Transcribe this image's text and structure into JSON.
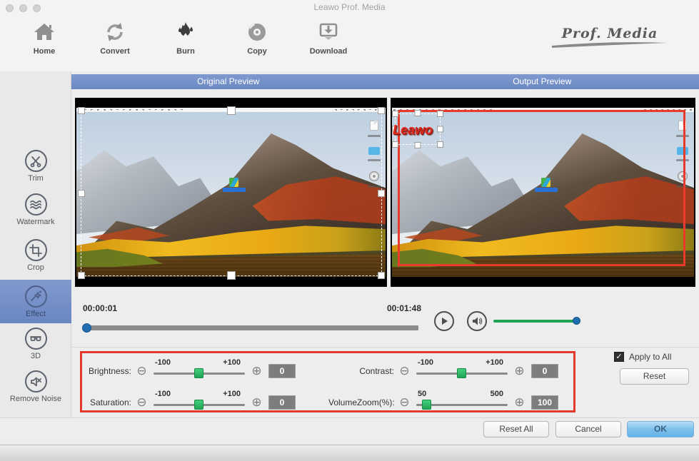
{
  "window": {
    "title": "Leawo Prof. Media",
    "brand": "Prof. Media"
  },
  "toolbar": {
    "items": [
      {
        "id": "home",
        "label": "Home"
      },
      {
        "id": "convert",
        "label": "Convert"
      },
      {
        "id": "burn",
        "label": "Burn"
      },
      {
        "id": "copy",
        "label": "Copy"
      },
      {
        "id": "download",
        "label": "Download"
      }
    ]
  },
  "sidebar": {
    "items": [
      {
        "id": "trim",
        "label": "Trim",
        "selected": false
      },
      {
        "id": "watermark",
        "label": "Watermark",
        "selected": false
      },
      {
        "id": "crop",
        "label": "Crop",
        "selected": false
      },
      {
        "id": "effect",
        "label": "Effect",
        "selected": true
      },
      {
        "id": "3d",
        "label": "3D",
        "selected": false
      },
      {
        "id": "remove-noise",
        "label": "Remove Noise",
        "selected": false
      }
    ]
  },
  "preview": {
    "original_label": "Original Preview",
    "output_label": "Output Preview",
    "watermark_text": "Leawo"
  },
  "timeline": {
    "current_time": "00:00:01",
    "total_time": "00:01:48"
  },
  "effects": {
    "sliders": [
      {
        "label": "Brightness:",
        "min": "-100",
        "max": "+100",
        "value": "0"
      },
      {
        "label": "Contrast:",
        "min": "-100",
        "max": "+100",
        "value": "0"
      },
      {
        "label": "Saturation:",
        "min": "-100",
        "max": "+100",
        "value": "0"
      },
      {
        "label": "VolumeZoom(%):",
        "min": "50",
        "max": "500",
        "value": "100"
      }
    ],
    "apply_to_all_label": "Apply to All",
    "apply_to_all_checked": true,
    "check_glyph": "✓",
    "minus_glyph": "⊖",
    "plus_glyph": "⊕",
    "reset_label": "Reset"
  },
  "footer": {
    "reset_all_label": "Reset All",
    "cancel_label": "Cancel",
    "ok_label": "OK"
  },
  "colors": {
    "header_blue": "#7e99ce",
    "selected_blue": "#7390c8",
    "frame_red": "#e23b2e",
    "slider_green": "#2fbf68",
    "volume_green": "#1da351",
    "thumb_blue": "#1f6cb0",
    "ok_blue": "#7cc0ec"
  }
}
